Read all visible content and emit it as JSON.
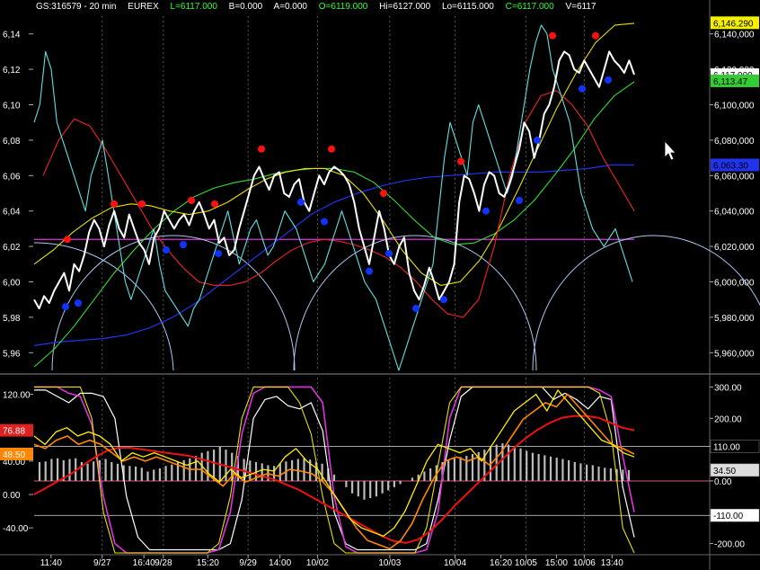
{
  "header": {
    "symbol": "GS:316579 - 20 min",
    "exchange": "EUREX",
    "last": "L=6117.000",
    "bid": "B=0.000",
    "ask": "A=0.000",
    "open": "O=6119.000",
    "high": "Hi=6127.000",
    "low": "Lo=6115.000",
    "close": "C=6117.000",
    "volume": "V=6117"
  },
  "colors": {
    "background": "#000000",
    "price": "#ffffff",
    "cyan": "#5fe0e0",
    "red": "#dd2222",
    "yellow": "#e8e000",
    "green": "#33dd33",
    "blue": "#2233ee",
    "magenta": "#dd33dd",
    "arc": "#aac8ee",
    "orange": "#ff8800",
    "hist": "#bbbbbb"
  },
  "chart_data": [
    {
      "type": "line",
      "panel": "price",
      "y_left_ticks": [
        "6,14",
        "6,12",
        "6,10",
        "6,08",
        "6,06",
        "6,04",
        "6,02",
        "6,00",
        "5,98",
        "5,96"
      ],
      "y_right_ticks": [
        "6,140,000",
        "6,120,000",
        "6,100,000",
        "6,080,000",
        "6,060,000",
        "6,040,000",
        "6,020,000",
        "6,000,000",
        "5,980,000",
        "5,960,000"
      ],
      "ylim": [
        5950,
        6150
      ],
      "right_badges": [
        {
          "label": "6,146.290",
          "value": 6146.29,
          "bg": "#f5f000",
          "fg": "#000000"
        },
        {
          "label": "6,117.000",
          "value": 6117,
          "bg": "#ffffff",
          "fg": "#000000"
        },
        {
          "label": "6,113.47",
          "value": 6113.47,
          "bg": "#33cc33",
          "fg": "#000000"
        },
        {
          "label": "6,063.30",
          "value": 6066,
          "bg": "#2233ee",
          "fg": "#000000"
        }
      ],
      "horizontal_line": {
        "value": 6024,
        "color": "#dd33dd"
      },
      "series": [
        {
          "key": "price",
          "values": [
            5990,
            5985,
            5992,
            5988,
            5995,
            6000,
            6005,
            5995,
            6010,
            6006,
            6015,
            6028,
            6035,
            6030,
            6020,
            6032,
            6040,
            6030,
            6025,
            6038,
            6030,
            6022,
            6018,
            6010,
            6025,
            6030,
            6040,
            6035,
            6030,
            6035,
            6038,
            6032,
            6040,
            6045,
            6038,
            6030,
            6035,
            6022,
            6025,
            6015,
            6018,
            6030,
            6040,
            6050,
            6060,
            6065,
            6058,
            6052,
            6060,
            6062,
            6050,
            6048,
            6055,
            6058,
            6045,
            6040,
            6050,
            6060,
            6055,
            6062,
            6065,
            6063,
            6060,
            6055,
            6045,
            6030,
            6020,
            6010,
            6025,
            6040,
            6030,
            6015,
            6010,
            6020,
            6025,
            6005,
            5995,
            5990,
            5998,
            6008,
            6000,
            5990,
            5995,
            6000,
            6010,
            6045,
            6060,
            6058,
            6050,
            6040,
            6055,
            6062,
            6060,
            6050,
            6048,
            6055,
            6065,
            6075,
            6090,
            6085,
            6070,
            6080,
            6095,
            6100,
            6110,
            6125,
            6130,
            6128,
            6120,
            6118,
            6125,
            6120,
            6115,
            6110,
            6120,
            6130,
            6125,
            6122,
            6118,
            6125,
            6117
          ]
        },
        {
          "key": "cyan",
          "values": [
            6090,
            6100,
            6130,
            6120,
            6090,
            6080,
            6070,
            6060,
            6050,
            6040,
            6060,
            6070,
            6080,
            6060,
            6040,
            6020,
            6000,
            5990,
            6000,
            6010,
            6020,
            6030,
            6010,
            5995,
            5990,
            5985,
            5980,
            5975,
            5985,
            5990,
            6000,
            6010,
            6020,
            6030,
            6040,
            6025,
            6010,
            6020,
            6030,
            6035,
            6025,
            6015,
            6020,
            6030,
            6040,
            6035,
            6030,
            6020,
            6010,
            6000,
            6005,
            6010,
            6020,
            6030,
            6040,
            6030,
            6020,
            6010,
            6000,
            5995,
            5990,
            5980,
            5970,
            5960,
            5950,
            5960,
            5970,
            5980,
            5990,
            6000,
            6010,
            6040,
            6070,
            6090,
            6080,
            6070,
            6060,
            6090,
            6100,
            6090,
            6080,
            6070,
            6060,
            6050,
            6060,
            6080,
            6100,
            6120,
            6135,
            6145,
            6140,
            6120,
            6110,
            6100,
            6090,
            6070,
            6050,
            6040,
            6030,
            6025,
            6020,
            6025,
            6030,
            6020,
            6010,
            6000
          ]
        },
        {
          "key": "red",
          "values": [
            6060,
            6080,
            6092,
            6088,
            6075,
            6060,
            6045,
            6030,
            6018,
            6008,
            6000,
            5998,
            5998,
            6000,
            6005,
            6012,
            6018,
            6022,
            6024,
            6023,
            6021,
            6018,
            6014,
            6008,
            6000,
            5990,
            5982,
            5980,
            5990,
            6020,
            6060,
            6090,
            6105,
            6108,
            6100,
            6088,
            6070,
            6055,
            6040
          ]
        },
        {
          "key": "yellow",
          "values": [
            6010,
            6018,
            6028,
            6036,
            6042,
            6044,
            6043,
            6040,
            6038,
            6040,
            6045,
            6052,
            6058,
            6062,
            6064,
            6064,
            6060,
            6050,
            6035,
            6018,
            6005,
            5998,
            6000,
            6012,
            6030,
            6052,
            6075,
            6098,
            6118,
            6135,
            6145,
            6146
          ]
        },
        {
          "key": "green",
          "values": [
            5952,
            5962,
            5975,
            5990,
            6005,
            6018,
            6030,
            6040,
            6048,
            6053,
            6056,
            6058,
            6061,
            6063,
            6064,
            6064,
            6062,
            6056,
            6046,
            6035,
            6025,
            6021,
            6022,
            6027,
            6035,
            6046,
            6060,
            6075,
            6092,
            6105,
            6113
          ]
        },
        {
          "key": "blue",
          "values": [
            5964,
            5966,
            5967,
            5968,
            5970,
            5974,
            5980,
            5988,
            5998,
            6008,
            6018,
            6028,
            6038,
            6045,
            6050,
            6054,
            6057,
            6059,
            6060,
            6061,
            6062,
            6062,
            6062,
            6063,
            6064,
            6066,
            6066
          ]
        }
      ],
      "red_markers": [
        6024,
        6044,
        6044,
        6046,
        6044,
        6075,
        6075,
        6050,
        6068,
        6139,
        6139
      ],
      "blue_markers": [
        5986,
        5988,
        6018,
        6021,
        6016,
        6045,
        6034,
        6045,
        6006,
        6016,
        5985,
        5990,
        6040,
        6046,
        6080,
        6109,
        6114
      ]
    },
    {
      "type": "line",
      "panel": "oscillator",
      "y_left_ticks": [
        "120.00",
        "80.00",
        "40.00",
        "0.00",
        "-40.00"
      ],
      "y_right_ticks": [
        "300.00",
        "200.00",
        "110.00",
        "0.00",
        "-110.00",
        "-200.00"
      ],
      "ylim_left": [
        -70,
        140
      ],
      "ylim_right": [
        -230,
        330
      ],
      "left_badges": [
        {
          "label": "76.88",
          "value": 76.88,
          "bg": "#dd2222"
        },
        {
          "label": "48.50",
          "value": 48.5,
          "bg": "#ff8800"
        }
      ],
      "right_badges": [
        {
          "label": "110.00",
          "value": 110,
          "bg": "#000000",
          "fg": "#ffffff"
        },
        {
          "label": "34.50",
          "value": 34.5,
          "bg": "#dddddd",
          "fg": "#000000"
        },
        {
          "label": "-110.00",
          "value": -110,
          "bg": "#ffffff",
          "fg": "#000000"
        }
      ],
      "reference_lines": [
        110,
        0,
        -110
      ],
      "series": [
        {
          "key": "white_osc",
          "values": [
            290,
            290,
            270,
            250,
            280,
            280,
            270,
            200,
            -50,
            -180,
            -220,
            -220,
            -220,
            -220,
            -220,
            -220,
            -220,
            -200,
            -60,
            200,
            260,
            270,
            240,
            230,
            250,
            160,
            -100,
            -200,
            -220,
            -220,
            -220,
            -220,
            -220,
            -220,
            -200,
            -60,
            130,
            270,
            300,
            300,
            300,
            300,
            300,
            300,
            300,
            260,
            280,
            260,
            230,
            270,
            260,
            -20,
            -180
          ]
        },
        {
          "key": "magenta",
          "values": [
            300,
            300,
            300,
            280,
            270,
            180,
            -50,
            -200,
            -230,
            -230,
            -230,
            -230,
            -230,
            -230,
            -230,
            -230,
            -220,
            -100,
            150,
            280,
            300,
            300,
            300,
            300,
            300,
            250,
            -50,
            -210,
            -230,
            -230,
            -230,
            -230,
            -230,
            -230,
            -220,
            -100,
            200,
            300,
            300,
            300,
            300,
            300,
            300,
            300,
            300,
            300,
            300,
            300,
            300,
            290,
            270,
            80,
            -100
          ]
        },
        {
          "key": "yellow_osc",
          "values": [
            300,
            300,
            300,
            300,
            300,
            200,
            -100,
            -230,
            -230,
            -230,
            -230,
            -230,
            -230,
            -230,
            -230,
            -230,
            -200,
            -50,
            200,
            300,
            300,
            300,
            300,
            250,
            150,
            -50,
            -200,
            -230,
            -230,
            -230,
            -230,
            -230,
            -230,
            -230,
            -150,
            50,
            250,
            300,
            300,
            300,
            300,
            300,
            300,
            300,
            300,
            300,
            300,
            300,
            300,
            280,
            150,
            -150,
            -230
          ]
        },
        {
          "key": "yellow_short",
          "values": [
            70,
            60,
            75,
            80,
            70,
            75,
            70,
            60,
            40,
            50,
            45,
            50,
            45,
            40,
            35,
            40,
            25,
            15,
            30,
            20,
            25,
            30,
            28,
            45,
            55,
            40,
            30,
            10,
            -10,
            -30,
            -40,
            -45,
            -50,
            -40,
            -20,
            10,
            40,
            60,
            55,
            50,
            55,
            40,
            60,
            80,
            100,
            110,
            120,
            100,
            125,
            110,
            95,
            80,
            65,
            60,
            50,
            45
          ]
        },
        {
          "key": "orange",
          "values": [
            60,
            55,
            65,
            70,
            60,
            65,
            60,
            50,
            40,
            45,
            40,
            45,
            40,
            35,
            30,
            30,
            20,
            10,
            25,
            15,
            20,
            25,
            22,
            30,
            28,
            25,
            15,
            0,
            -20,
            -40,
            -55,
            -60,
            -65,
            -55,
            -35,
            -5,
            20,
            40,
            45,
            40,
            45,
            35,
            50,
            70,
            90,
            100,
            110,
            105,
            120,
            105,
            90,
            75,
            60,
            55,
            48.5
          ]
        },
        {
          "key": "red_osc",
          "values": [
            0,
            8,
            16,
            24,
            34,
            44,
            52,
            56,
            56,
            54,
            52,
            50,
            48,
            46,
            42,
            38,
            34,
            30,
            26,
            22,
            18,
            12,
            6,
            -2,
            -10,
            -18,
            -26,
            -34,
            -42,
            -50,
            -56,
            -58,
            -54,
            -44,
            -30,
            -14,
            0,
            14,
            28,
            42,
            56,
            68,
            78,
            86,
            92,
            94,
            94,
            92,
            86,
            80,
            76.88
          ]
        },
        {
          "key": "hist",
          "values": [
            60,
            62,
            70,
            72,
            66,
            70,
            72,
            60,
            55,
            62,
            66,
            70,
            60,
            55,
            50,
            48,
            46,
            42,
            30,
            36,
            40,
            48,
            52,
            60,
            66,
            72,
            80,
            90,
            95,
            100,
            110,
            100,
            90,
            80,
            70,
            65,
            60,
            56,
            50,
            48,
            55,
            62,
            66,
            70,
            72,
            68,
            60,
            55,
            40,
            20,
            0,
            -20,
            -40,
            -50,
            -60,
            -55,
            -50,
            -40,
            -30,
            -20,
            -10,
            0,
            10,
            20,
            30,
            40,
            50,
            60,
            66,
            72,
            76,
            80,
            86,
            92,
            100,
            108,
            116,
            120,
            116,
            110,
            104,
            96,
            90,
            86,
            82,
            78,
            74,
            70,
            66,
            60,
            56,
            52,
            50,
            46,
            42,
            40,
            38,
            36,
            34.5
          ]
        }
      ]
    }
  ],
  "x_axis": {
    "labels": [
      {
        "text": "11:40",
        "frac": 0.0282
      },
      {
        "text": "9/27",
        "frac": 0.1134
      },
      {
        "text": "16:40",
        "frac": 0.1829
      },
      {
        "text": "9/28",
        "frac": 0.2153
      },
      {
        "text": "15:20",
        "frac": 0.2894
      },
      {
        "text": "9/29",
        "frac": 0.3565
      },
      {
        "text": "14:00",
        "frac": 0.4097
      },
      {
        "text": "10/02",
        "frac": 0.4722
      },
      {
        "text": "10/03",
        "frac": 0.5926
      },
      {
        "text": "10/04",
        "frac": 0.7014
      },
      {
        "text": "16:20",
        "frac": 0.7778
      },
      {
        "text": "10/05",
        "frac": 0.8194
      },
      {
        "text": "15:00",
        "frac": 0.8704
      },
      {
        "text": "10/06",
        "frac": 0.9167
      },
      {
        "text": "13:40",
        "frac": 0.963
      }
    ],
    "day_separators": [
      0.1134,
      0.2153,
      0.3565,
      0.4722,
      0.5926,
      0.7014,
      0.8194,
      0.9167
    ]
  }
}
